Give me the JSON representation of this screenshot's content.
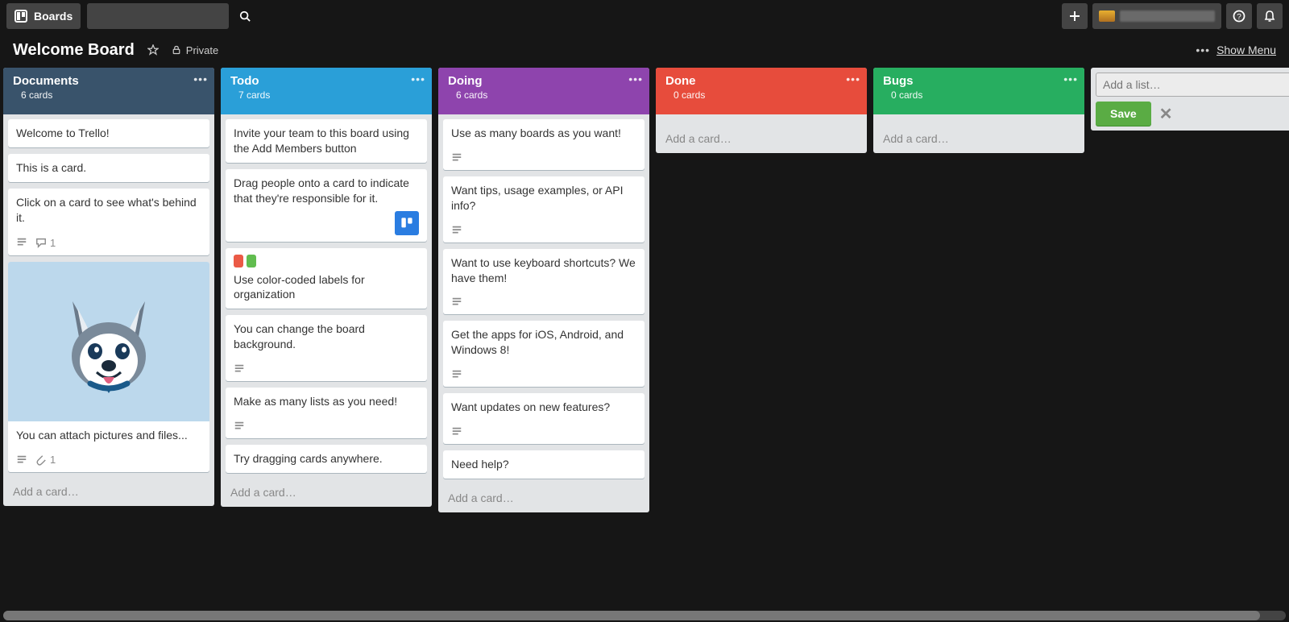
{
  "topbar": {
    "boards_label": "Boards"
  },
  "board_header": {
    "title": "Welcome Board",
    "privacy": "Private",
    "show_menu": "Show Menu"
  },
  "add_list": {
    "placeholder": "Add a list…",
    "save_label": "Save"
  },
  "add_card_label": "Add a card…",
  "lists": [
    {
      "id": "documents",
      "name": "Documents",
      "count": "6 cards",
      "header_class": "hdr-documents",
      "cards": [
        {
          "title": "Welcome to Trello!"
        },
        {
          "title": "This is a card."
        },
        {
          "title": "Click on a card to see what's behind it.",
          "has_desc": true,
          "comments": 1
        },
        {
          "title": "You can attach pictures and files...",
          "cover": true,
          "has_desc": true,
          "attachments": 1
        }
      ]
    },
    {
      "id": "todo",
      "name": "Todo",
      "count": "7 cards",
      "header_class": "hdr-todo",
      "cards": [
        {
          "title": "Invite your team to this board using the Add Members button"
        },
        {
          "title": "Drag people onto a card to indicate that they're responsible for it.",
          "member": true
        },
        {
          "title": "Use color-coded labels for organization",
          "labels": [
            "red",
            "green"
          ]
        },
        {
          "title": "You can change the board background.",
          "has_desc": true
        },
        {
          "title": "Make as many lists as you need!",
          "has_desc": true
        },
        {
          "title": "Try dragging cards anywhere."
        }
      ]
    },
    {
      "id": "doing",
      "name": "Doing",
      "count": "6 cards",
      "header_class": "hdr-doing",
      "cards": [
        {
          "title": "Use as many boards as you want!",
          "has_desc": true
        },
        {
          "title": "Want tips, usage examples, or API info?",
          "has_desc": true
        },
        {
          "title": "Want to use keyboard shortcuts? We have them!",
          "has_desc": true
        },
        {
          "title": "Get the apps for iOS, Android, and Windows 8!",
          "has_desc": true
        },
        {
          "title": "Want updates on new features?",
          "has_desc": true
        },
        {
          "title": "Need help?"
        }
      ]
    },
    {
      "id": "done",
      "name": "Done",
      "count": "0 cards",
      "header_class": "hdr-done",
      "cards": []
    },
    {
      "id": "bugs",
      "name": "Bugs",
      "count": "0 cards",
      "header_class": "hdr-bugs",
      "cards": []
    }
  ]
}
